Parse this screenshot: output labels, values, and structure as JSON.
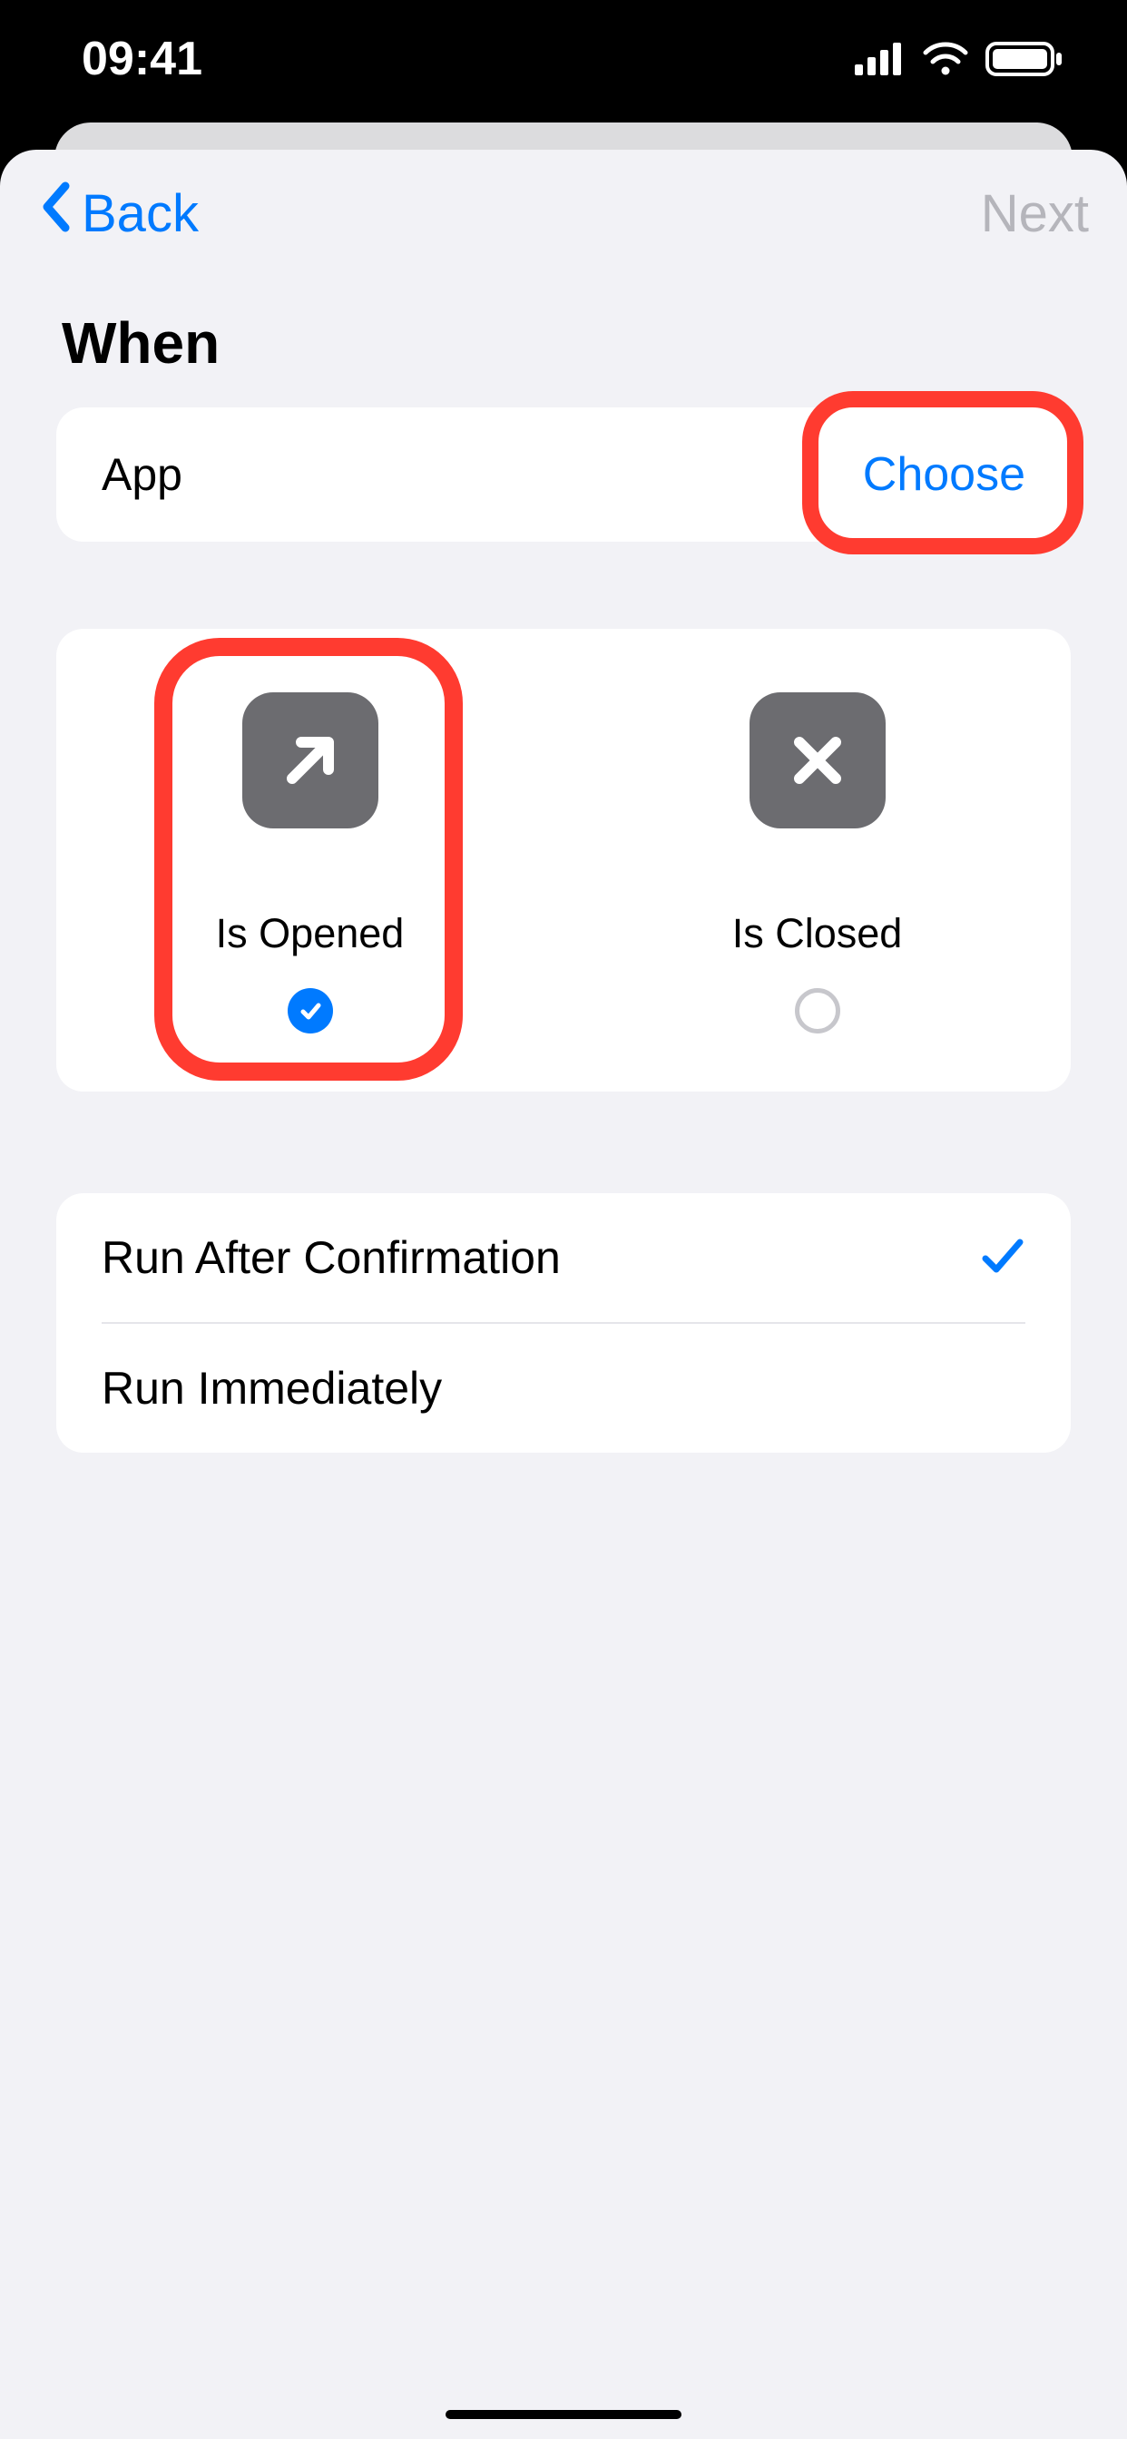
{
  "status": {
    "time": "09:41"
  },
  "nav": {
    "back": "Back",
    "next": "Next"
  },
  "section": {
    "title": "When"
  },
  "app_row": {
    "label": "App",
    "action": "Choose"
  },
  "triggers": {
    "opened": {
      "label": "Is Opened",
      "selected": true
    },
    "closed": {
      "label": "Is Closed",
      "selected": false
    }
  },
  "run_modes": {
    "confirm": {
      "label": "Run After Confirmation",
      "selected": true
    },
    "immediate": {
      "label": "Run Immediately",
      "selected": false
    }
  }
}
